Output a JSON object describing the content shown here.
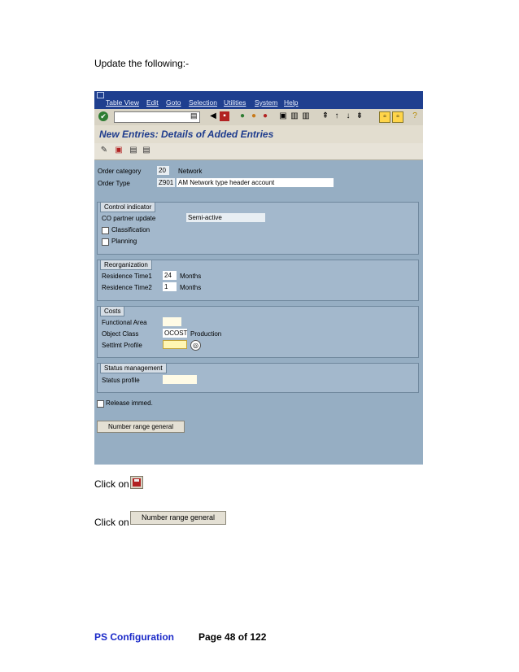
{
  "document": {
    "intro": "Update the following:-",
    "click_on_1": "Click on",
    "click_on_2": "Click on",
    "footer_left": "PS  Configuration",
    "footer_right": "Page 48 of 122"
  },
  "sap": {
    "menu": [
      "Table View",
      "Edit",
      "Goto",
      "Selection",
      "Utilities",
      "System",
      "Help"
    ],
    "title": "New Entries: Details of Added Entries",
    "header": {
      "order_category_label": "Order category",
      "order_category_value": "20",
      "order_category_text": "Network",
      "order_type_label": "Order Type",
      "order_type_value": "Z901",
      "order_type_text": "AM Network type header account"
    },
    "control": {
      "title": "Control indicator",
      "co_partner_label": "CO partner update",
      "co_partner_value": "Semi-active",
      "classification_label": "Classification",
      "planning_label": "Planning"
    },
    "reorg": {
      "title": "Reorganization",
      "rt1_label": "Residence Time1",
      "rt1_value": "24",
      "rt1_unit": "Months",
      "rt2_label": "Residence Time2",
      "rt2_value": "1",
      "rt2_unit": "Months"
    },
    "costs": {
      "title": "Costs",
      "functional_area_label": "Functional Area",
      "functional_area_value": "",
      "object_class_label": "Object Class",
      "object_class_value": "OCOST",
      "object_class_text": "Production",
      "settlmt_label": "Settlmt Profile",
      "settlmt_value": ""
    },
    "status": {
      "title": "Status management",
      "status_profile_label": "Status profile",
      "status_profile_value": ""
    },
    "release_label": "Release immed.",
    "number_range_button": "Number range general"
  },
  "instruction_button": "Number range general",
  "colors": {
    "menubar": "#1f3f8f",
    "screen_bg": "#96aec3",
    "title_text": "#1d3b8d",
    "footer_blue": "#1a29c8"
  },
  "icons": [
    "sap-system-icon",
    "enter-check-icon",
    "save-icon",
    "back-icon",
    "exit-icon",
    "cancel-icon",
    "print-icon",
    "find-icon",
    "help-icon",
    "edit-pencil-icon",
    "copy-icon",
    "delete-icon"
  ]
}
